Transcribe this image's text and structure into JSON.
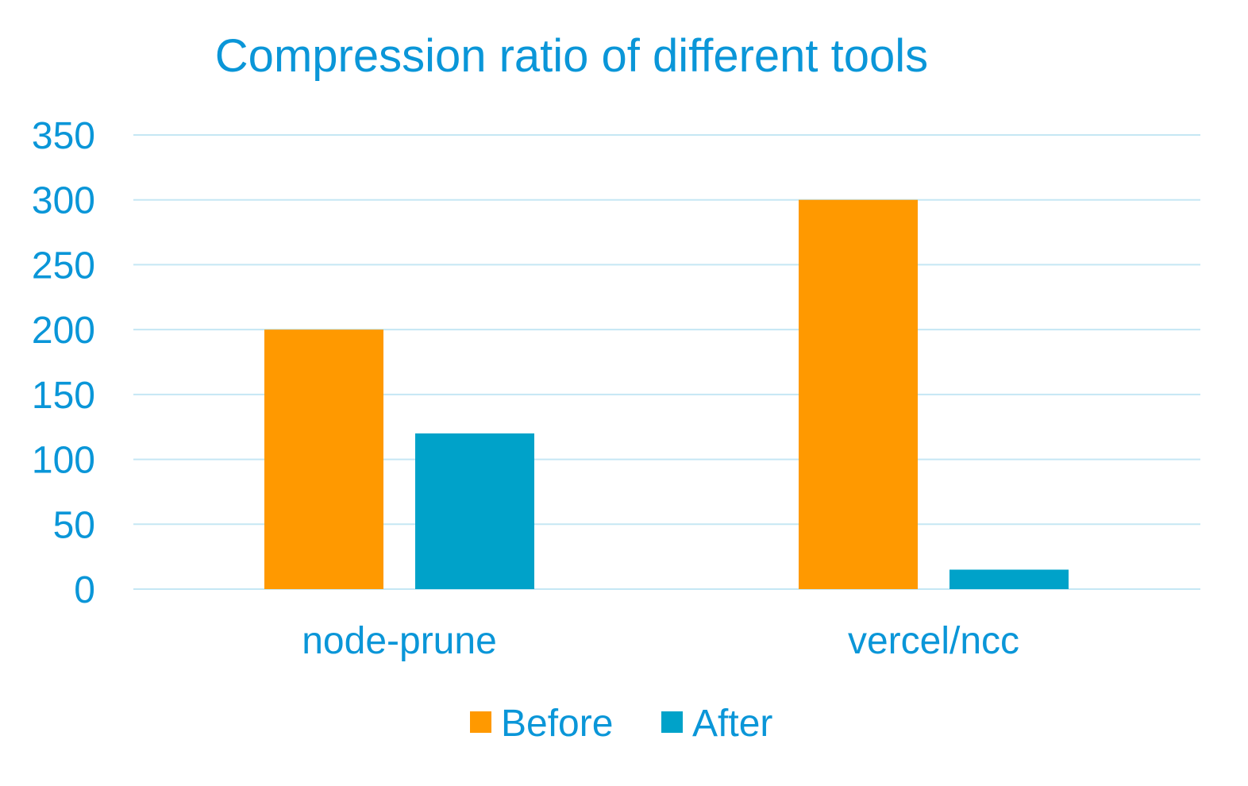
{
  "colors": {
    "text": "#0a96d8",
    "grid": "#c5e7f4",
    "before": "#ff9900",
    "after": "#00a2c9"
  },
  "chart_data": {
    "type": "bar",
    "title": "Compression ratio of different tools",
    "xlabel": "",
    "ylabel": "",
    "categories": [
      "node-prune",
      "vercel/ncc"
    ],
    "series": [
      {
        "name": "Before",
        "values": [
          200,
          300
        ]
      },
      {
        "name": "After",
        "values": [
          120,
          15
        ]
      }
    ],
    "ylim": [
      0,
      350
    ],
    "yticks": [
      0,
      50,
      100,
      150,
      200,
      250,
      300,
      350
    ],
    "grid": true,
    "legend_position": "bottom"
  }
}
